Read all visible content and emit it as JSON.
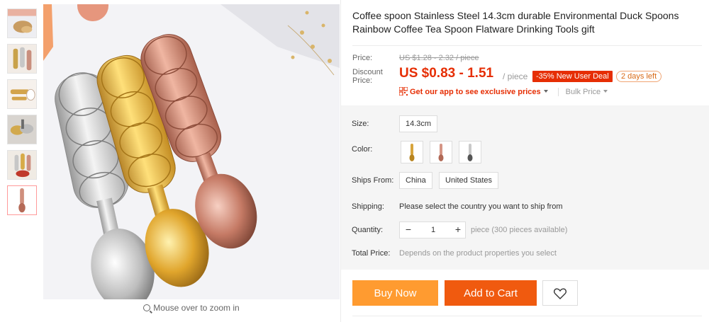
{
  "gallery": {
    "thumbnails": [
      {
        "name": "thumb-1",
        "active": false
      },
      {
        "name": "thumb-2",
        "active": false
      },
      {
        "name": "thumb-3",
        "active": false
      },
      {
        "name": "thumb-4",
        "active": false
      },
      {
        "name": "thumb-5",
        "active": false
      },
      {
        "name": "thumb-6",
        "active": true
      }
    ],
    "zoom_hint": "Mouse over to zoom in"
  },
  "product": {
    "title": "Coffee spoon Stainless Steel 14.3cm durable Environmental Duck Spoons Rainbow Coffee Tea Spoon Flatware Drinking Tools gift",
    "price_label": "Price:",
    "original_price": "US $1.28 - 2.32 / piece",
    "discount_label": "Discount Price:",
    "discount_price": "US $0.83 - 1.51",
    "per_piece": "/ piece",
    "deal_badge": "-35% New User Deal",
    "days_left": "2 days left",
    "app_link": "Get our app to see exclusive prices",
    "bulk_price": "Bulk Price",
    "colors": {
      "accent": "#e62e04",
      "buy": "#ff9b30",
      "cart": "#f05a0f"
    }
  },
  "properties": {
    "size_label": "Size:",
    "size_value": "14.3cm",
    "color_label": "Color:",
    "color_options": [
      "gold",
      "rose-gold",
      "silver"
    ],
    "ships_from_label": "Ships From:",
    "ships_from_options": [
      "China",
      "United States"
    ],
    "shipping_label": "Shipping:",
    "shipping_text": "Please select the country you want to ship from",
    "quantity_label": "Quantity:",
    "quantity_value": "1",
    "quantity_minus": "−",
    "quantity_plus": "+",
    "quantity_note": "piece (300 pieces available)",
    "total_label": "Total Price:",
    "total_text": "Depends on the product properties you select"
  },
  "actions": {
    "buy_now": "Buy Now",
    "add_to_cart": "Add to Cart",
    "wishlist_icon": "heart-icon"
  }
}
